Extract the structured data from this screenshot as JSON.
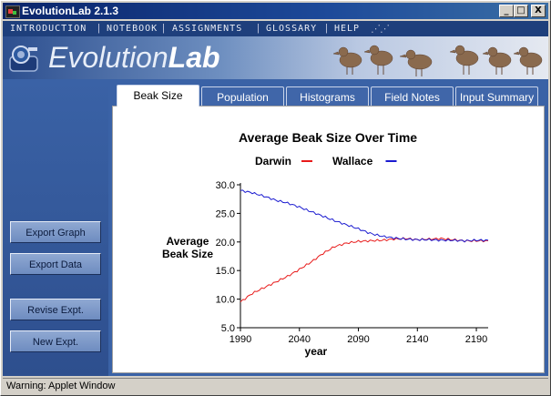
{
  "window": {
    "title": "EvolutionLab 2.1.3",
    "min_label": "_",
    "max_label": "□",
    "close_label": "X"
  },
  "menu": {
    "items": [
      "INTRODUCTION",
      "NOTEBOOK",
      "ASSIGNMENTS",
      "GLOSSARY",
      "HELP"
    ]
  },
  "banner": {
    "logo_light": "Evolution",
    "logo_bold": "Lab"
  },
  "sidebar": {
    "buttons": [
      "Export Graph",
      "Export Data",
      "Revise Expt.",
      "New Expt."
    ]
  },
  "tabs": [
    "Beak Size",
    "Population",
    "Histograms",
    "Field Notes",
    "Input Summary"
  ],
  "active_tab": "Beak Size",
  "status": {
    "text": "Warning: Applet Window"
  },
  "colors": {
    "darwin": "#e81a1a",
    "wallace": "#1a1ad0",
    "accent": "#3a62a6"
  },
  "chart_data": {
    "type": "line",
    "title": "Average Beak Size Over Time",
    "xlabel": "year",
    "ylabel": "Average Beak Size",
    "xlim": [
      1990,
      2200
    ],
    "ylim": [
      5.0,
      30.0
    ],
    "xticks": [
      1990,
      2040,
      2090,
      2140,
      2190
    ],
    "yticks": [
      5.0,
      10.0,
      15.0,
      20.0,
      25.0,
      30.0
    ],
    "ytick_labels": [
      "5.0",
      "10.0",
      "15.0",
      "20.0",
      "25.0",
      "30.0"
    ],
    "legend_position": "top",
    "x": [
      1990,
      2000,
      2010,
      2020,
      2030,
      2040,
      2050,
      2060,
      2070,
      2080,
      2090,
      2100,
      2110,
      2120,
      2130,
      2140,
      2150,
      2160,
      2170,
      2180,
      2190,
      2200
    ],
    "series": [
      {
        "name": "Darwin",
        "color": "#e81a1a",
        "values": [
          9.5,
          11.0,
          12.0,
          13.0,
          14.0,
          15.2,
          16.5,
          18.0,
          19.2,
          19.8,
          20.1,
          20.2,
          20.3,
          20.5,
          20.6,
          20.4,
          20.5,
          20.6,
          20.4,
          20.2,
          20.2,
          20.2
        ]
      },
      {
        "name": "Wallace",
        "color": "#1a1ad0",
        "values": [
          29.0,
          28.6,
          28.0,
          27.3,
          26.8,
          26.1,
          25.3,
          24.5,
          23.7,
          23.0,
          22.3,
          21.5,
          21.0,
          20.7,
          20.5,
          20.4,
          20.4,
          20.3,
          20.3,
          20.2,
          20.3,
          20.3
        ]
      }
    ]
  }
}
